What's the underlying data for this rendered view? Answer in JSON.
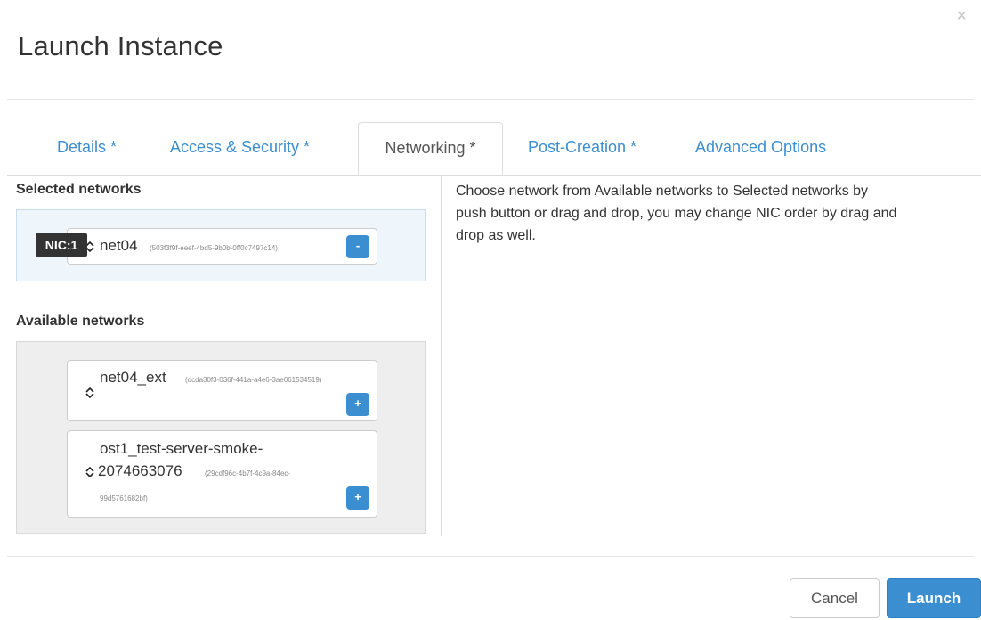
{
  "dialog": {
    "title": "Launch Instance",
    "close_icon": "×"
  },
  "tabs": [
    {
      "label": "Details *"
    },
    {
      "label": "Access & Security *"
    },
    {
      "label": "Networking *"
    },
    {
      "label": "Post-Creation *"
    },
    {
      "label": "Advanced Options"
    }
  ],
  "active_tab": "Networking *",
  "selected_networks": {
    "label": "Selected networks",
    "items": [
      {
        "nic": "NIC:1",
        "name": "net04",
        "id": "(503f3f9f-eeef-4bd5-9b0b-0ff0c7497c14)",
        "button": "-"
      }
    ]
  },
  "available_networks": {
    "label": "Available networks",
    "items": [
      {
        "name": "net04_ext",
        "id": "(dcda30f3-036f-441a-a4e6-3ae061534519)",
        "button": "+"
      },
      {
        "name_line1": "ost1_test-server-smoke-",
        "name_line2": "2074663076",
        "id_part1": "(29cdf96c-4b7f-4c9a-84ec-",
        "id_part2": "99d5761682bf)",
        "button": "+"
      }
    ]
  },
  "help_text": "Choose network from Available networks to Selected networks by push button or drag and drop, you may change NIC order by drag and drop as well.",
  "footer": {
    "cancel": "Cancel",
    "launch": "Launch"
  },
  "colors": {
    "accent": "#3b8ed0",
    "selected_bg": "#eef6fc",
    "available_bg": "#eeeeee"
  },
  "icons": {
    "sort": "sort-arrows-icon",
    "close": "close-icon"
  }
}
